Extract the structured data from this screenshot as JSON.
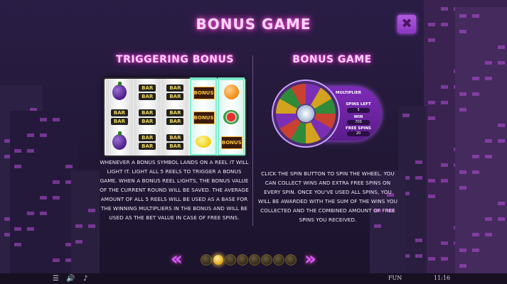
{
  "header": {
    "title": "BONUS GAME",
    "close_icon": "close-x-icon"
  },
  "left": {
    "heading": "TRIGGERING BONUS",
    "reels": [
      [
        "plum",
        "bar",
        "plum"
      ],
      [
        "bar",
        "bar",
        "bar"
      ],
      [
        "bar",
        "bar",
        "bar"
      ],
      [
        "bonus",
        "bonus",
        "lemon"
      ],
      [
        "orange",
        "watermelon",
        "bonus"
      ]
    ],
    "bar_label": "BAR",
    "bonus_label": "BONUS",
    "description": "WHENEVER A BONUS SYMBOL LANDS ON A REEL IT WILL LIGHT IT. LIGHT ALL 5 REELS TO TRIGGER A BONUS GAME. WHEN A BONUS REEL LIGHTS, THE BONUS VALUE OF THE CURRENT ROUND WILL BE SAVED. THE AVERAGE AMOUNT OF ALL 5 REELS WILL BE USED AS A BASE FOR THE WINNING MULTIPLIERS IN THE BONUS AND WILL BE USED AS THE BET VALUE IN CASE OF FREE SPINS."
  },
  "right": {
    "heading": "BONUS GAME",
    "panel": {
      "multiplier_label": "MULTIPLIER",
      "spins_left_label": "SPINS LEFT",
      "spins_left_value": "3",
      "win_label": "WIN",
      "win_value": "700",
      "free_spins_label": "FREE SPINS",
      "free_spins_value": "20"
    },
    "description": "CLICK THE SPIN BUTTON TO SPIN THE WHEEL. YOU CAN COLLECT WINS AND EXTRA FREE SPINS ON EVERY SPIN. ONCE YOU'VE USED ALL SPINS, YOU WILL BE AWARDED WITH THE SUM OF THE WINS YOU COLLECTED AND THE COMBINED AMOUNT OF FREE SPINS YOU RECEIVED."
  },
  "pagination": {
    "prev_label": "«",
    "next_label": "»",
    "pages": 8,
    "active_index": 1
  },
  "footer": {
    "menu_icon": "menu-icon",
    "sound_icon": "sound-icon",
    "music_icon": "music-icon",
    "mode": "FUN",
    "time": "11:16"
  },
  "colors": {
    "accent": "#ff4bd8",
    "highlight_reel": "#7ff0d0",
    "panel": "#7e2bb8"
  }
}
